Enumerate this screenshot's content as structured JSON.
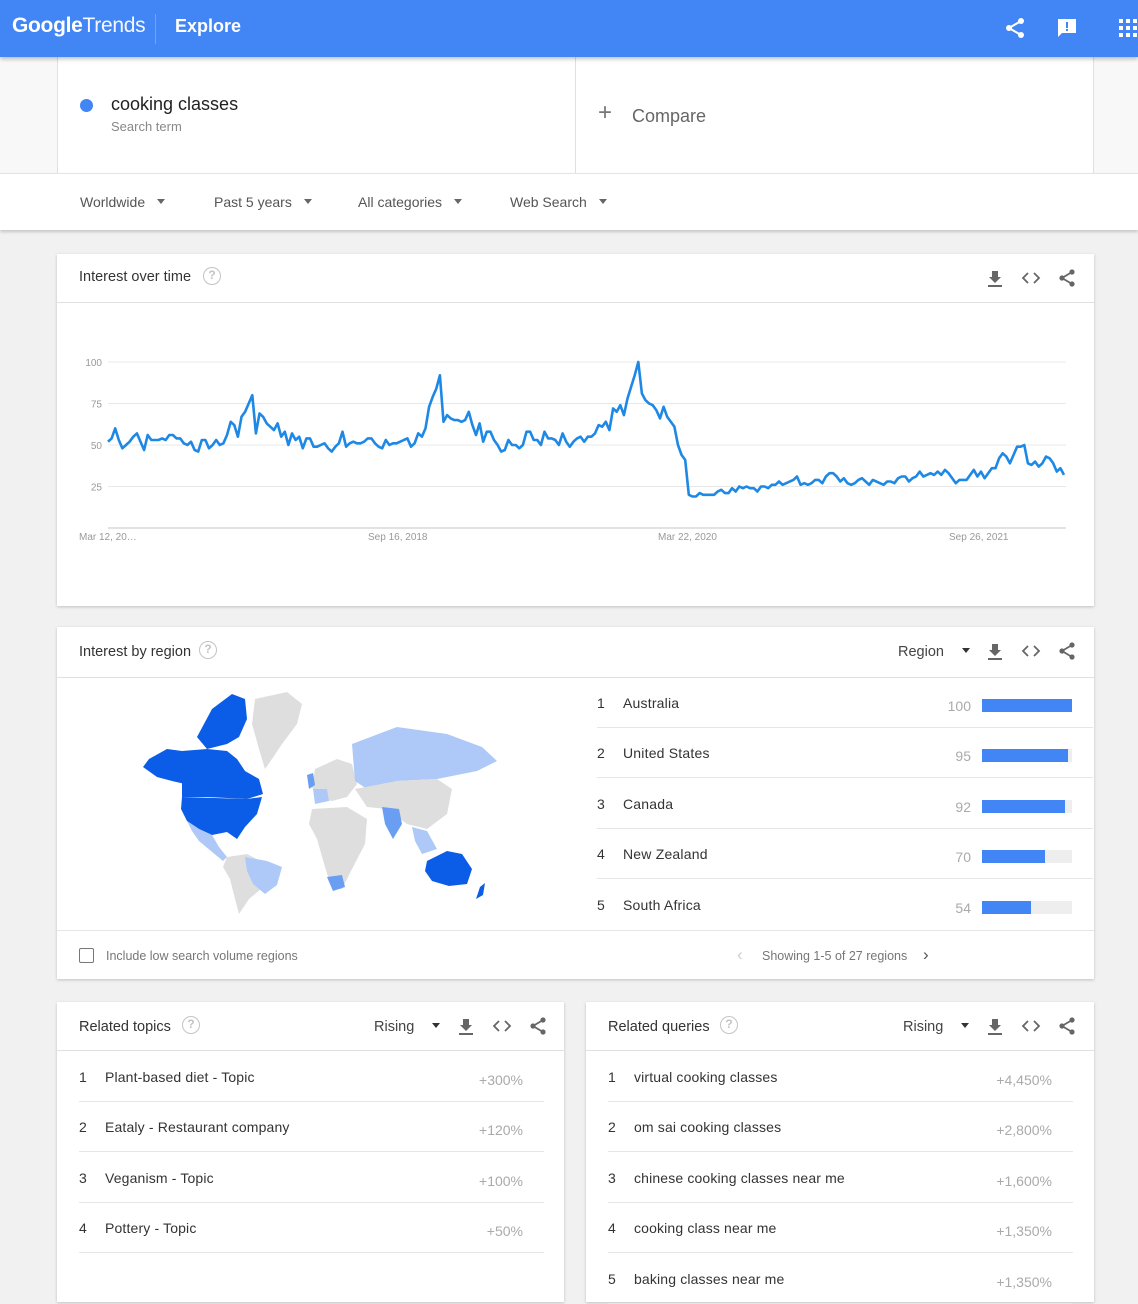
{
  "topbar": {
    "logo_google": "Google",
    "logo_trends": "Trends",
    "page": "Explore",
    "icons": [
      "share-icon",
      "feedback-icon",
      "apps-icon"
    ],
    "brand_color": "#4285f4"
  },
  "search": {
    "term": "cooking classes",
    "term_type": "Search term",
    "term_color": "#4285f4",
    "compare_label": "Compare"
  },
  "filters": {
    "geo": "Worldwide",
    "time": "Past 5 years",
    "category": "All categories",
    "property": "Web Search"
  },
  "interest_over_time": {
    "title": "Interest over time",
    "help": "?"
  },
  "chart_data": {
    "type": "line",
    "title": "Interest over time",
    "series": [
      {
        "name": "cooking classes",
        "color": "#1e88e5",
        "values": [
          52,
          54,
          60,
          53,
          48,
          50,
          52,
          55,
          57,
          52,
          47,
          56,
          53,
          53,
          53,
          54,
          53,
          56,
          56,
          54,
          54,
          51,
          50,
          52,
          47,
          46,
          53,
          53,
          48,
          50,
          53,
          50,
          51,
          56,
          64,
          62,
          55,
          67,
          70,
          75,
          80,
          57,
          69,
          67,
          63,
          61,
          59,
          63,
          55,
          58,
          50,
          57,
          53,
          55,
          48,
          54,
          54,
          49,
          49,
          50,
          51,
          48,
          46,
          49,
          51,
          58,
          49,
          51,
          52,
          51,
          51,
          52,
          54,
          54,
          51,
          49,
          48,
          53,
          50,
          51,
          51,
          52,
          53,
          54,
          49,
          51,
          57,
          55,
          60,
          73,
          79,
          84,
          92,
          64,
          68,
          66,
          65,
          65,
          64,
          65,
          70,
          62,
          56,
          63,
          52,
          58,
          58,
          53,
          50,
          46,
          47,
          53,
          50,
          50,
          48,
          50,
          58,
          58,
          53,
          53,
          50,
          58,
          54,
          54,
          53,
          50,
          57,
          52,
          49,
          52,
          54,
          55,
          52,
          55,
          55,
          57,
          62,
          61,
          64,
          59,
          72,
          70,
          74,
          68,
          78,
          85,
          92,
          100,
          81,
          77,
          75,
          74,
          71,
          66,
          73,
          67,
          64,
          61,
          50,
          44,
          41,
          20,
          19,
          19,
          21,
          20,
          20,
          20,
          20,
          22,
          23,
          21,
          21,
          24,
          22,
          25,
          24,
          25,
          24,
          24,
          22,
          25,
          25,
          24,
          26,
          26,
          28,
          26,
          27,
          28,
          29,
          31,
          26,
          27,
          26,
          27,
          29,
          29,
          27,
          31,
          33,
          33,
          31,
          28,
          30,
          27,
          26,
          27,
          29,
          30,
          28,
          26,
          29,
          28,
          27,
          26,
          28,
          28,
          27,
          30,
          31,
          31,
          28,
          30,
          31,
          34,
          31,
          32,
          33,
          32,
          34,
          32,
          35,
          33,
          30,
          27,
          29,
          29,
          29,
          32,
          35,
          31,
          34,
          30,
          33,
          36,
          36,
          42,
          45,
          43,
          39,
          44,
          49,
          49,
          50,
          39,
          38,
          40,
          37,
          39,
          43,
          42,
          39,
          34,
          36,
          32
        ]
      }
    ],
    "x_tick_labels": [
      "Mar 12, 20…",
      "Sep 16, 2018",
      "Mar 22, 2020",
      "Sep 26, 2021"
    ],
    "y_ticks": [
      25,
      50,
      75,
      100
    ],
    "ylim": [
      0,
      100
    ],
    "grid": true,
    "legend": "none"
  },
  "interest_by_region": {
    "title": "Interest by region",
    "help": "?",
    "resolution": "Region",
    "regions": [
      {
        "rank": "1",
        "name": "Australia",
        "value": "100",
        "fraction": 1.0
      },
      {
        "rank": "2",
        "name": "United States",
        "value": "95",
        "fraction": 0.95
      },
      {
        "rank": "3",
        "name": "Canada",
        "value": "92",
        "fraction": 0.92
      },
      {
        "rank": "4",
        "name": "New Zealand",
        "value": "70",
        "fraction": 0.7
      },
      {
        "rank": "5",
        "name": "South Africa",
        "value": "54",
        "fraction": 0.54
      }
    ],
    "checkbox_label": "Include low search volume regions",
    "pager_text": "Showing 1-5 of 27 regions",
    "map_colors": {
      "high": "#0b5ce6",
      "mid": "#6a9ef2",
      "low": "#aec9f7",
      "none": "#dedede"
    }
  },
  "related_topics": {
    "title": "Related topics",
    "help": "?",
    "mode": "Rising",
    "items": [
      {
        "rank": "1",
        "name": "Plant-based diet - Topic",
        "value": "+300%"
      },
      {
        "rank": "2",
        "name": "Eataly - Restaurant company",
        "value": "+120%"
      },
      {
        "rank": "3",
        "name": "Veganism - Topic",
        "value": "+100%"
      },
      {
        "rank": "4",
        "name": "Pottery - Topic",
        "value": "+50%"
      }
    ]
  },
  "related_queries": {
    "title": "Related queries",
    "help": "?",
    "mode": "Rising",
    "items": [
      {
        "rank": "1",
        "name": "virtual cooking classes",
        "value": "+4,450%"
      },
      {
        "rank": "2",
        "name": "om sai cooking classes",
        "value": "+2,800%"
      },
      {
        "rank": "3",
        "name": "chinese cooking classes near me",
        "value": "+1,600%"
      },
      {
        "rank": "4",
        "name": "cooking class near me",
        "value": "+1,350%"
      },
      {
        "rank": "5",
        "name": "baking classes near me",
        "value": "+1,350%"
      }
    ]
  }
}
